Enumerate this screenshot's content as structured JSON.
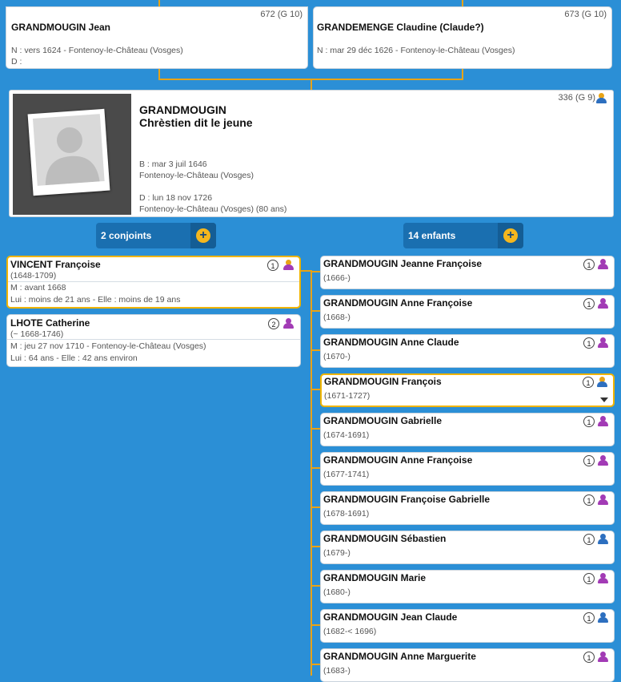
{
  "parents": [
    {
      "name": "GRANDMOUGIN Jean",
      "gen": "672 (G 10)",
      "line1": "N : vers 1624 - Fontenoy-le-Château (Vosges)",
      "line2": "D :"
    },
    {
      "name": "GRANDEMENGE Claudine (Claude?)",
      "gen": "673 (G 10)",
      "line1": "N : mar 29 déc 1626 - Fontenoy-le-Château (Vosges)"
    }
  ],
  "main": {
    "lastname": "GRANDMOUGIN",
    "firstname": "Chrèstien dit le jeune",
    "gen": "336 (G 9)",
    "birth": "B : mar 3 juil 1646",
    "birth_place": "Fontenoy-le-Château (Vosges)",
    "death": "D : lun 18 nov 1726",
    "death_place": "Fontenoy-le-Château (Vosges) (80 ans)"
  },
  "spouses_header": {
    "label": "2 conjoints",
    "plus": "+"
  },
  "children_header": {
    "label": "14 enfants",
    "plus": "+"
  },
  "spouses": [
    {
      "name": "VINCENT Françoise",
      "dates": "(1648-1709)",
      "num": "1",
      "m": "M : avant 1668",
      "ages": "Lui : moins de 21 ans - Elle : moins de 19 ans"
    },
    {
      "name": "LHOTE Catherine",
      "dates": "(~ 1668-1746)",
      "num": "2",
      "m": "M : jeu 27 nov 1710 - Fontenoy-le-Château (Vosges)",
      "ages": "Lui : 64 ans - Elle : 42 ans environ"
    }
  ],
  "children": [
    {
      "name": "GRANDMOUGIN Jeanne Françoise",
      "dates": "(1666-)",
      "num": "1"
    },
    {
      "name": "GRANDMOUGIN Anne Françoise",
      "dates": "(1668-)",
      "num": "1"
    },
    {
      "name": "GRANDMOUGIN Anne Claude",
      "dates": "(1670-)",
      "num": "1"
    },
    {
      "name": "GRANDMOUGIN François",
      "dates": "(1671-1727)",
      "num": "1"
    },
    {
      "name": "GRANDMOUGIN Gabrielle",
      "dates": "(1674-1691)",
      "num": "1"
    },
    {
      "name": "GRANDMOUGIN Anne Françoise",
      "dates": "(1677-1741)",
      "num": "1"
    },
    {
      "name": "GRANDMOUGIN Françoise Gabrielle",
      "dates": "(1678-1691)",
      "num": "1"
    },
    {
      "name": "GRANDMOUGIN Sébastien",
      "dates": "(1679-)",
      "num": "1"
    },
    {
      "name": "GRANDMOUGIN Marie",
      "dates": "(1680-)",
      "num": "1"
    },
    {
      "name": "GRANDMOUGIN Jean Claude",
      "dates": "(1682-< 1696)",
      "num": "1"
    },
    {
      "name": "GRANDMOUGIN Anne Marguerite",
      "dates": "(1683-)",
      "num": "1"
    }
  ],
  "colors": {
    "background": "#2b8fd6",
    "connector": "#e8a317",
    "highlight": "#f0b400",
    "female": "#a23bb5",
    "male": "#2d6fbf"
  }
}
